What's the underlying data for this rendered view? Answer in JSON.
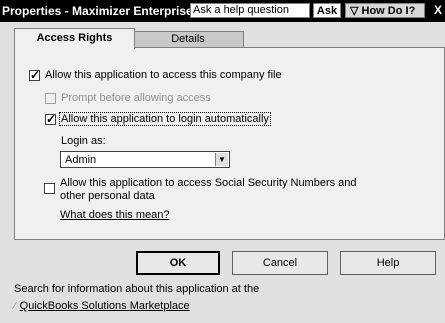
{
  "titlebar": {
    "title": "Properties - Maximizer Enterprise",
    "help_placeholder": "Ask a help question",
    "ask_label": "Ask",
    "how_do_label": "▽ How Do I?",
    "close_label": "X"
  },
  "tabs": [
    {
      "label": "Access Rights",
      "active": true
    },
    {
      "label": "Details",
      "active": false
    }
  ],
  "access": {
    "allow_access_label": "Allow this application to access this company file",
    "allow_access_checked": true,
    "prompt_label": "Prompt before allowing access",
    "prompt_checked": false,
    "login_auto_label": "Allow this application to login automatically",
    "login_auto_checked": true,
    "login_as_label": "Login as:",
    "login_as_value": "Admin",
    "ssn_label_line1": "Allow this application to access Social Security Numbers and",
    "ssn_label_line2": "other personal data",
    "ssn_checked": false,
    "what_link": "What does this mean?"
  },
  "buttons": {
    "ok": "OK",
    "cancel": "Cancel",
    "help": "Help"
  },
  "footer": {
    "info_text": "Search for information about this application at the",
    "marketplace_link": "QuickBooks Solutions Marketplace"
  }
}
